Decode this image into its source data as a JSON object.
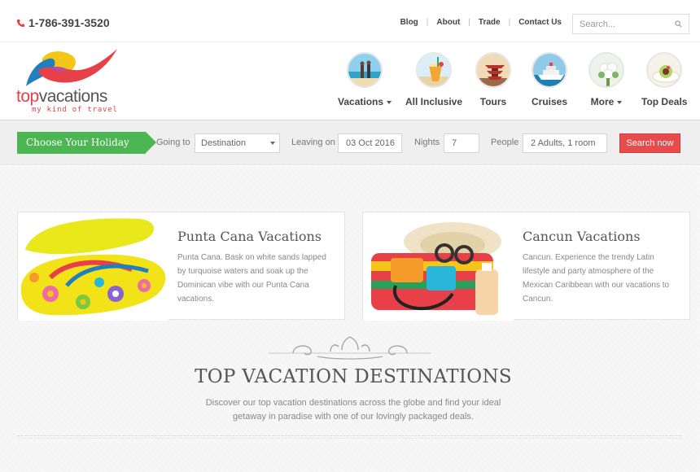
{
  "topbar": {
    "phone": "1-786-391-3520",
    "links": [
      "Blog",
      "About",
      "Trade",
      "Contact Us"
    ],
    "search_placeholder": "Search..."
  },
  "logo": {
    "brand_top": "top",
    "brand_vacations": "vacations",
    "tagline": "my kind of travel",
    "colors": {
      "primary": "#e84049",
      "secondary": "#1f7fc1",
      "accent": "#f5c518"
    }
  },
  "nav": [
    {
      "label": "Vacations",
      "icon": "beach-couple-icon",
      "dropdown": true
    },
    {
      "label": "All Inclusive",
      "icon": "cocktail-icon",
      "dropdown": false
    },
    {
      "label": "Tours",
      "icon": "pagoda-icon",
      "dropdown": false
    },
    {
      "label": "Cruises",
      "icon": "cruise-ship-icon",
      "dropdown": false
    },
    {
      "label": "More",
      "icon": "bouquet-icon",
      "dropdown": true
    },
    {
      "label": "Top Deals",
      "icon": "dessert-icon",
      "dropdown": false
    }
  ],
  "booking": {
    "cta": "Choose Your Holiday",
    "going_to_label": "Going to",
    "destination_value": "Destination",
    "leaving_on_label": "Leaving on",
    "leaving_on_value": "03 Oct 2016",
    "nights_label": "Nights",
    "nights_value": "7",
    "people_label": "People",
    "people_value": "2 Adults, 1 room",
    "search_button": "Search now",
    "accent_color": "#4cb653",
    "button_color": "#e84b4b"
  },
  "cards": [
    {
      "title": "Punta Cana Vacations",
      "description": "Punta Cana. Bask on white sands lapped by turquoise waters and soak up the Dominican vibe with our Punta Cana vacations.",
      "image": "flip-flops-image"
    },
    {
      "title": "Cancun Vacations",
      "description": "Cancun. Experience the trendy Latin lifestyle and party atmosphere of the Mexican Caribbean with our vacations to Cancun.",
      "image": "beach-bag-image"
    }
  ],
  "section": {
    "title": "TOP VACATION DESTINATIONS",
    "description": "Discover our top vacation destinations across the globe and find your ideal getaway in paradise with one of our lovingly packaged deals."
  }
}
